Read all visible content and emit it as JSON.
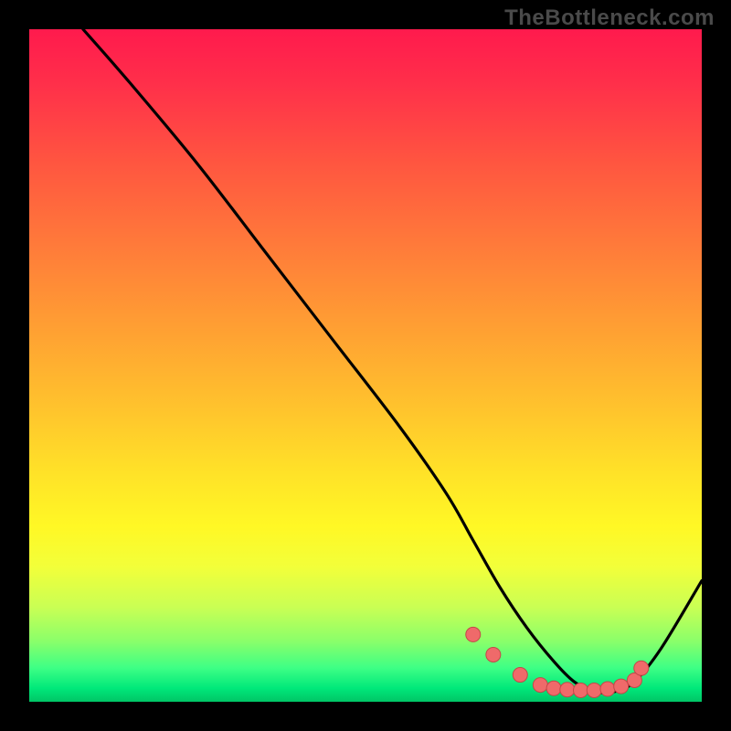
{
  "watermark": "TheBottleneck.com",
  "chart_data": {
    "type": "line",
    "title": "",
    "xlabel": "",
    "ylabel": "",
    "xlim": [
      0,
      100
    ],
    "ylim": [
      0,
      100
    ],
    "grid": false,
    "legend": false,
    "background_gradient": {
      "stops": [
        {
          "pos": 0,
          "color": "#ff1a4d"
        },
        {
          "pos": 20,
          "color": "#ff5640"
        },
        {
          "pos": 44,
          "color": "#ff9e33"
        },
        {
          "pos": 66,
          "color": "#ffe228"
        },
        {
          "pos": 86,
          "color": "#c9ff54"
        },
        {
          "pos": 100,
          "color": "#00c566"
        }
      ]
    },
    "series": [
      {
        "name": "bottleneck-curve",
        "x": [
          8,
          15,
          25,
          35,
          45,
          55,
          62,
          66,
          70,
          74,
          78,
          81,
          84,
          87,
          90,
          94,
          100
        ],
        "y": [
          100,
          92,
          80,
          67,
          54,
          41,
          31,
          24,
          17,
          11,
          6,
          3,
          1.5,
          1.5,
          3,
          8,
          18
        ]
      }
    ],
    "markers": {
      "name": "highlight-dots",
      "x": [
        66,
        69,
        73,
        76,
        78,
        80,
        82,
        84,
        86,
        88,
        90,
        91
      ],
      "y": [
        10,
        7,
        4,
        2.5,
        2,
        1.8,
        1.7,
        1.7,
        1.9,
        2.3,
        3.2,
        5
      ],
      "color": "#ef6a6a"
    }
  }
}
